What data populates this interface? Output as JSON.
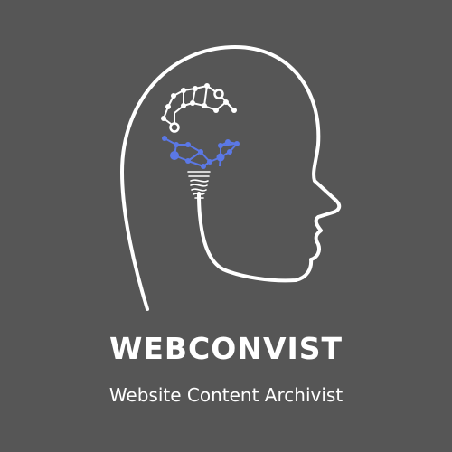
{
  "logo": {
    "brand_name": "WEBCONVIST",
    "tagline": "Website Content Archivist",
    "icon_name": "head-profile-brain-network-icon"
  },
  "colors": {
    "background": "#565656",
    "foreground": "#ffffff",
    "accent": "#5b78e6"
  }
}
